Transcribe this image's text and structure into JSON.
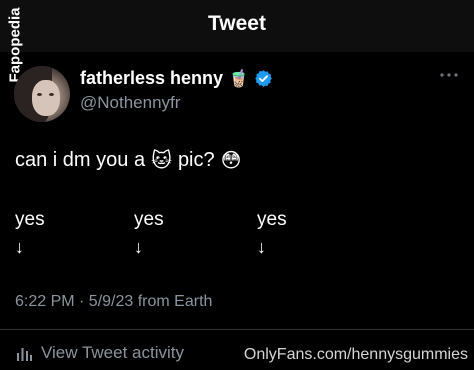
{
  "header": {
    "title": "Tweet"
  },
  "watermark_side": "Fapopedia",
  "author": {
    "display_name": "fatherless henny",
    "handle": "@Nothennyfr",
    "name_emoji": "🧋",
    "verified": true,
    "verified_color": "#1d9bf0"
  },
  "tweet": {
    "text_before": "can i dm you a",
    "emoji_cat": "🐱",
    "text_after": "pic?",
    "emoji_flushed": "😳",
    "columns": [
      {
        "label": "yes",
        "arrow": "↓"
      },
      {
        "label": "yes",
        "arrow": "↓"
      },
      {
        "label": "yes",
        "arrow": "↓"
      }
    ]
  },
  "meta": {
    "timestamp": "6:22 PM · 5/9/23 from Earth"
  },
  "footer": {
    "activity_label": "View Tweet activity",
    "watermark": "OnlyFans.com/hennysgummies"
  },
  "icons": {
    "more": "more-horizontal-icon",
    "verified": "verified-badge-icon",
    "activity": "bar-chart-icon"
  }
}
